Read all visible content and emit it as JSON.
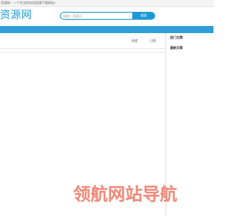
{
  "topbar": {
    "tagline": "资源网 - 一个专注的实用资源下载网站！"
  },
  "header": {
    "logo_text": "资源网",
    "search": {
      "placeholder": "请输入关键词",
      "button_label": "搜索"
    }
  },
  "main": {
    "columns": {
      "hot": "热度",
      "date": "日期"
    }
  },
  "sidebar": {
    "hot_articles_title": "热门文章",
    "latest_articles_title": "最新文章"
  },
  "watermark": {
    "text": "领航网站导航"
  },
  "colors": {
    "brand": "#1c9ad6",
    "navbar": "#2e9fd8",
    "watermark": "#f08878"
  }
}
